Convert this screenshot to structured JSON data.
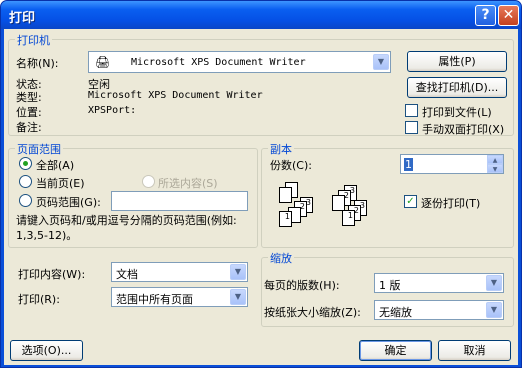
{
  "window": {
    "title": "打印",
    "help": "?",
    "close": "✕"
  },
  "printer": {
    "group": "打印机",
    "name_label": "名称(N):",
    "name_value": "Microsoft XPS Document Writer",
    "properties": "属性(P)",
    "find": "查找打印机(D)...",
    "status_label": "状态:",
    "status_value": "空闲",
    "type_label": "类型:",
    "type_value": "Microsoft XPS Document Writer",
    "location_label": "位置:",
    "location_value": "XPSPort:",
    "comment_label": "备注:",
    "print_to_file": "打印到文件(L)",
    "manual_duplex": "手动双面打印(X)"
  },
  "range": {
    "group": "页面范围",
    "all": "全部(A)",
    "current": "当前页(E)",
    "selection": "所选内容(S)",
    "pages": "页码范围(G):",
    "pages_value": "",
    "hint": "请键入页码和/或用逗号分隔的页码范围(例如: 1,3,5-12)。"
  },
  "copies": {
    "group": "副本",
    "count_label": "份数(C):",
    "count_value": "1",
    "collate": "逐份打印(T)",
    "collate_checked": "✓",
    "page_nums": [
      "1",
      "2",
      "3"
    ]
  },
  "print_what": {
    "label": "打印内容(W):",
    "value": "文档"
  },
  "print_opt": {
    "label": "打印(R):",
    "value": "范围中所有页面"
  },
  "zoom": {
    "group": "缩放",
    "pps_label": "每页的版数(H):",
    "pps_value": "1 版",
    "scale_label": "按纸张大小缩放(Z):",
    "scale_value": "无缩放"
  },
  "footer": {
    "options": "选项(O)...",
    "ok": "确定",
    "cancel": "取消"
  }
}
